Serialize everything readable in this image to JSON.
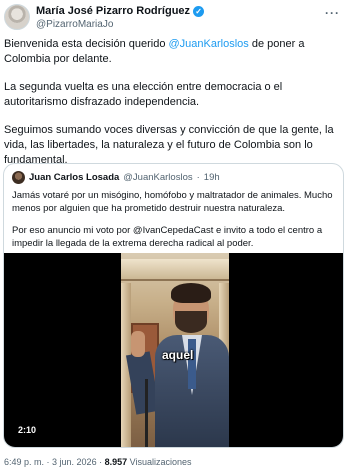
{
  "author": {
    "name": "María José Pizarro Rodríguez",
    "handle": "@PizarroMariaJo",
    "verified_icon": "verified-badge-icon",
    "more_icon": "more-options-icon"
  },
  "tweet": {
    "p1_before": "Bienvenida esta decisión querido ",
    "p1_mention": "@JuanKarloslos",
    "p1_after": " de poner a Colombia por delante.",
    "p2": "La segunda vuelta es una elección entre democracia o el autoritarismo disfrazado independencia.",
    "p3": "Seguimos sumando voces diversas y convicción de que la gente, la vida, las libertades, la naturaleza y el futuro de Colombia son lo fundamental."
  },
  "quote": {
    "name": "Juan Carlos Losada",
    "handle": "@JuanKarloslos",
    "sep": "·",
    "time": "19h",
    "p1": "Jamás votaré por un misógino, homófobo y maltratador de animales. Mucho menos por alguien que ha prometido destruir nuestra naturaleza.",
    "p2": "Por eso anuncio mi voto por @IvanCepedaCast e invito a todo el centro a impedir la llegada de la extrema derecha radical al poder.",
    "video": {
      "caption": "aquel",
      "duration": "2:10"
    }
  },
  "footer": {
    "time": "6:49 p. m.",
    "sep1": " · ",
    "date": "3 jun. 2026",
    "sep2": " · ",
    "views": "8.957",
    "views_label": " Visualizaciones"
  }
}
